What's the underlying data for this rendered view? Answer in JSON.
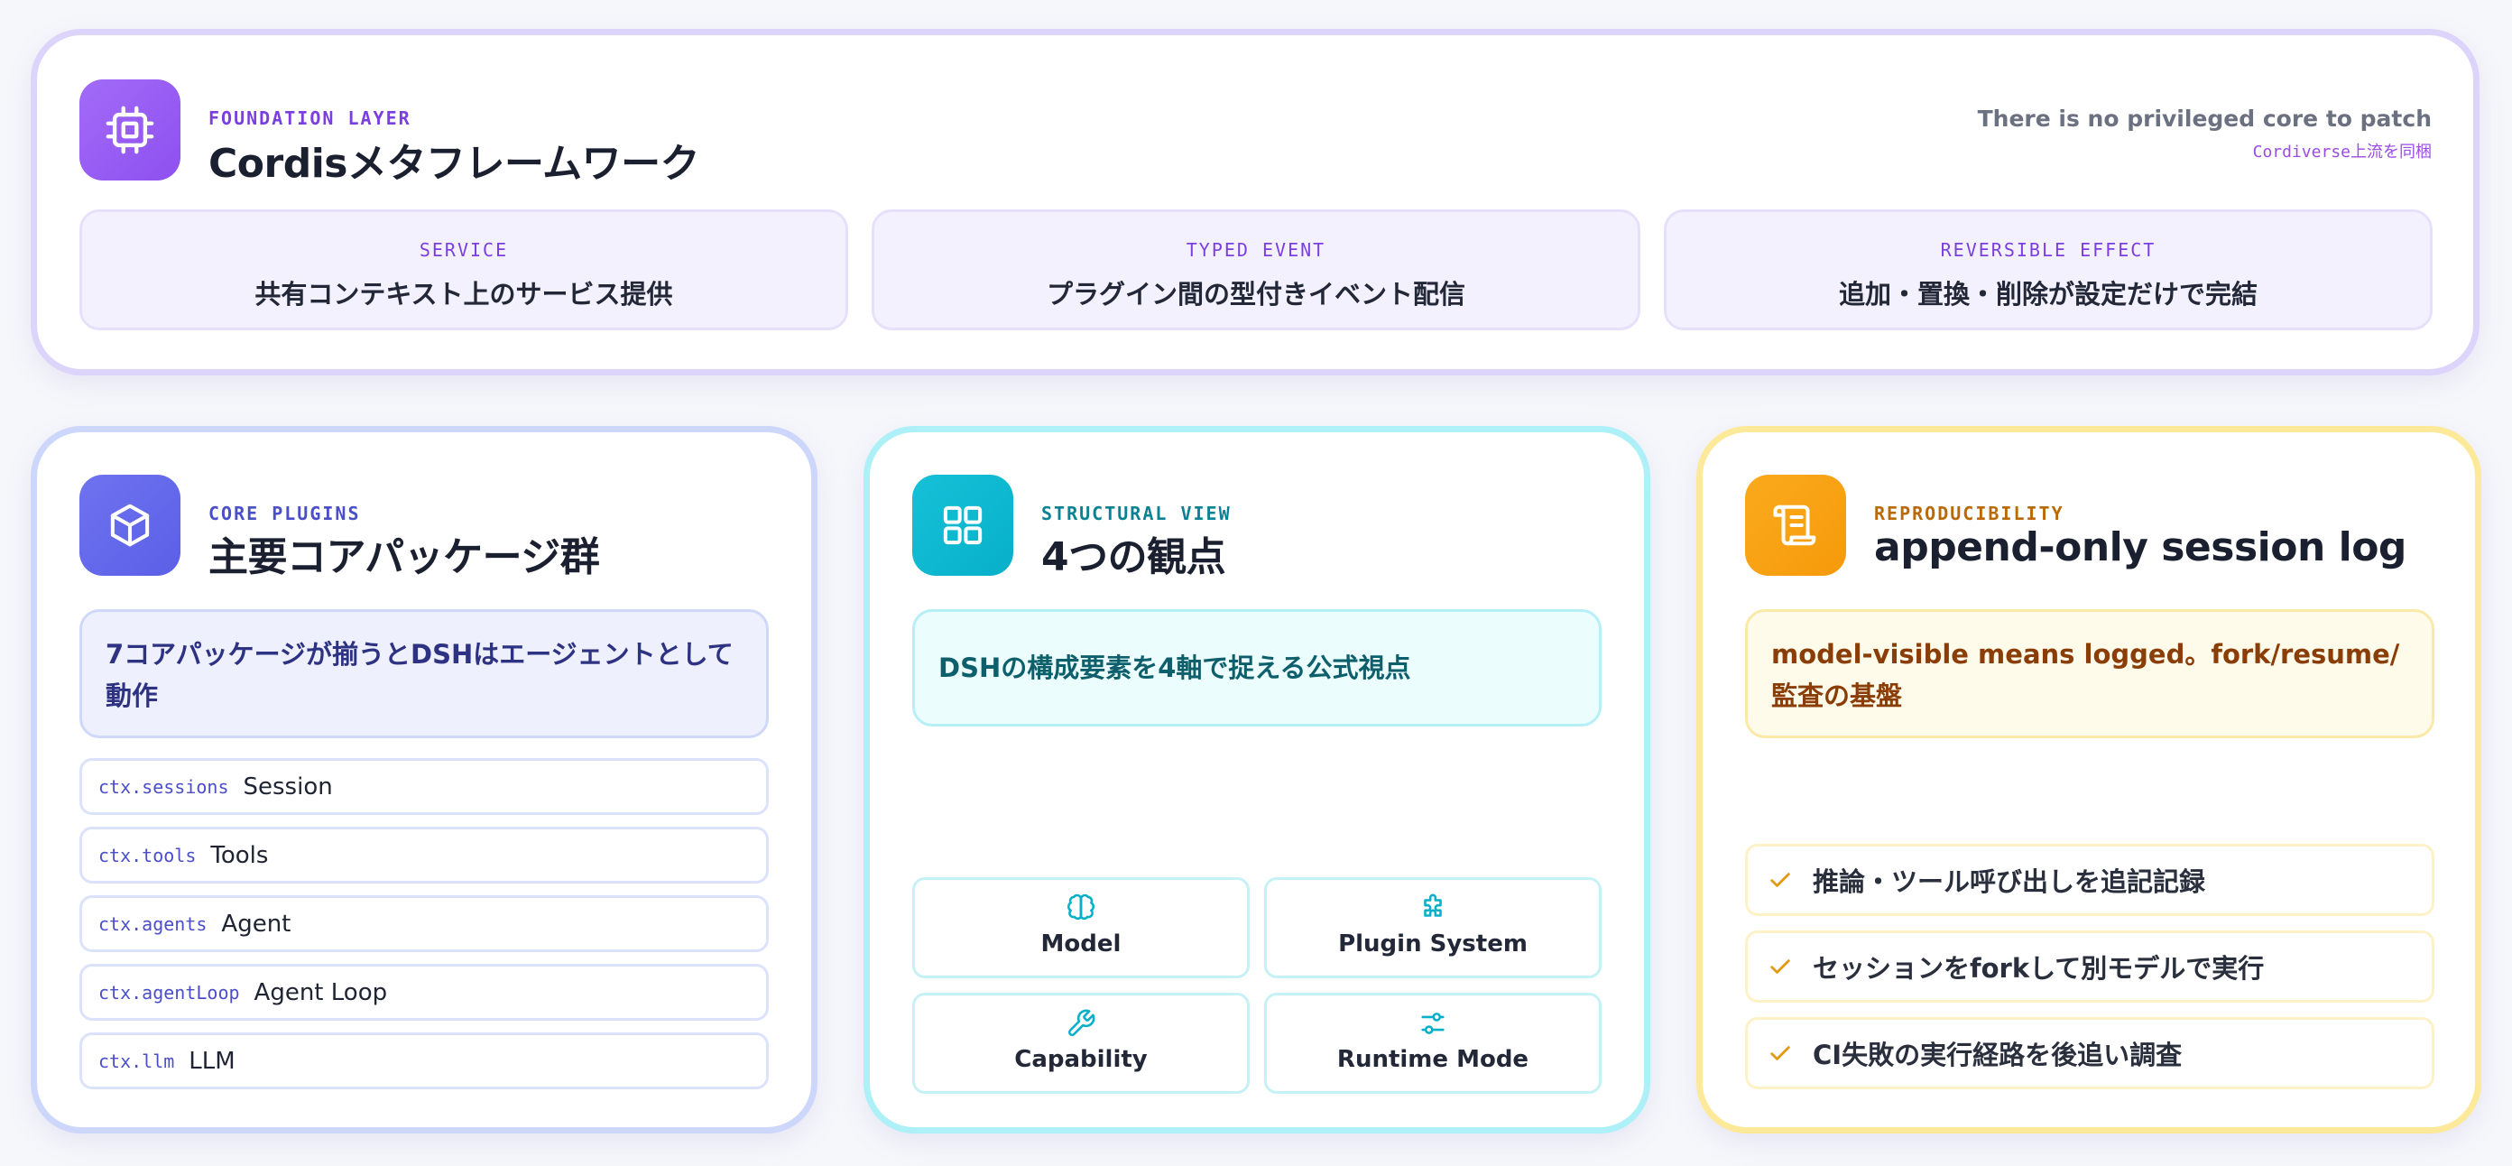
{
  "colors": {
    "foundation_accent": "#8e50f0",
    "core_accent": "#5a5fe6",
    "structural_accent": "#07b0c8",
    "repro_accent": "#f59a0a"
  },
  "foundation": {
    "icon": "cpu-chip-icon",
    "kicker": "FOUNDATION LAYER",
    "title": "Cordisメタフレームワーク",
    "tagline": "There is no privileged core to patch",
    "tagline_sub": "Cordiverse上流を同梱",
    "pillars": [
      {
        "kicker": "SERVICE",
        "text": "共有コンテキスト上のサービス提供"
      },
      {
        "kicker": "TYPED EVENT",
        "text": "プラグイン間の型付きイベント配信"
      },
      {
        "kicker": "REVERSIBLE EFFECT",
        "text": "追加・置換・削除が設定だけで完結"
      }
    ]
  },
  "core": {
    "icon": "package-cube-icon",
    "kicker": "CORE PLUGINS",
    "title": "主要コアパッケージ群",
    "callout": "7コアパッケージが揃うとDSHはエージェントとして動作",
    "packages": [
      {
        "code": "ctx.sessions",
        "label": "Session"
      },
      {
        "code": "ctx.tools",
        "label": "Tools"
      },
      {
        "code": "ctx.agents",
        "label": "Agent"
      },
      {
        "code": "ctx.agentLoop",
        "label": "Agent Loop"
      },
      {
        "code": "ctx.llm",
        "label": "LLM"
      }
    ]
  },
  "structural": {
    "icon": "grid-icon",
    "kicker": "STRUCTURAL VIEW",
    "title": "4つの観点",
    "callout": "DSHの構成要素を4軸で捉える公式視点",
    "facets": [
      {
        "icon": "brain-icon",
        "label": "Model"
      },
      {
        "icon": "puzzle-icon",
        "label": "Plugin System"
      },
      {
        "icon": "wrench-icon",
        "label": "Capability"
      },
      {
        "icon": "sliders-icon",
        "label": "Runtime Mode"
      }
    ]
  },
  "repro": {
    "icon": "scroll-icon",
    "kicker": "REPRODUCIBILITY",
    "title": "append-only session log",
    "callout": "model-visible means logged。fork/resume/監査の基盤",
    "checks": [
      {
        "text": "推論・ツール呼び出しを追記記録"
      },
      {
        "text": "セッションをforkして別モデルで実行"
      },
      {
        "text": "CI失敗の実行経路を後追い調査"
      }
    ]
  }
}
